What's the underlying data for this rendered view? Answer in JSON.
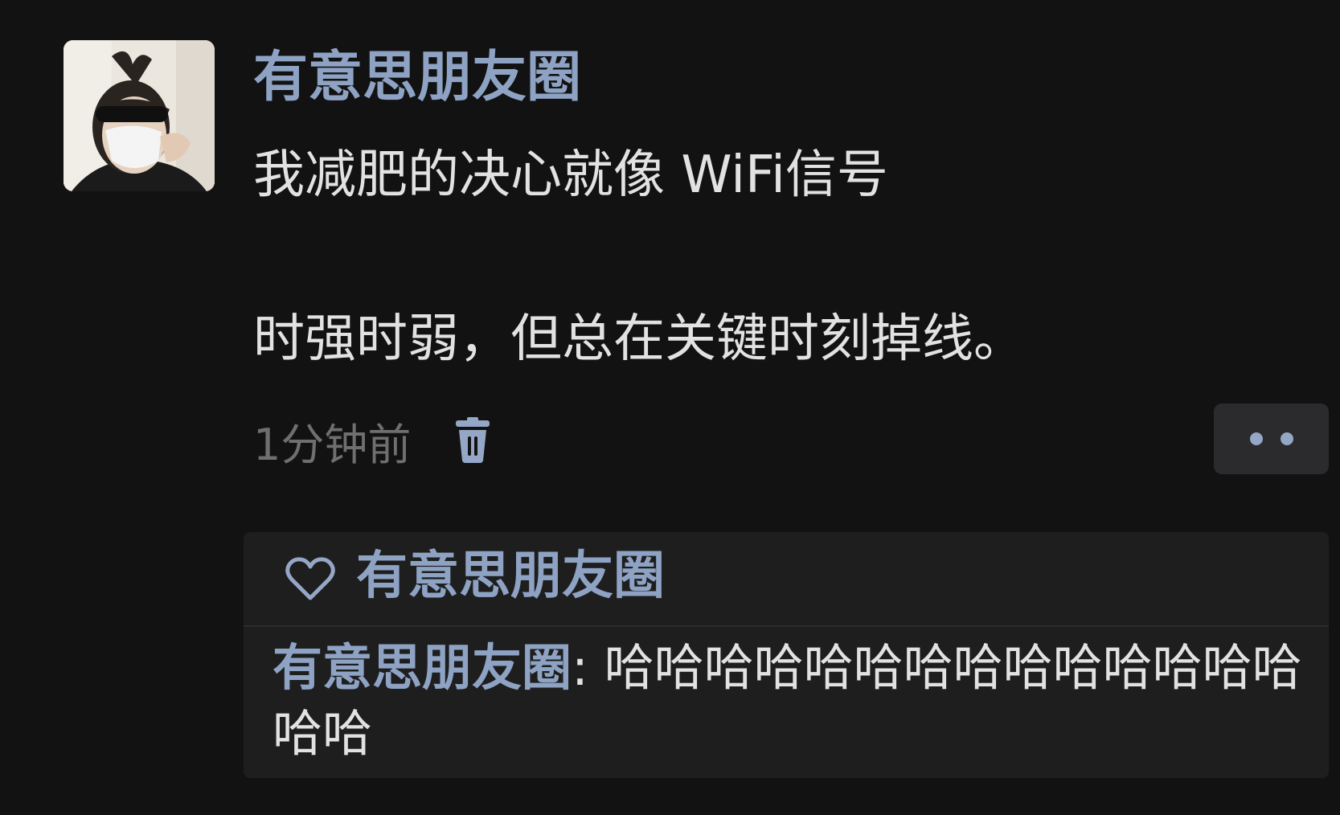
{
  "post": {
    "author": "有意思朋友圈",
    "text_line_1": "我减肥的决心就像 WiFi信号",
    "text_line_2": "时强时弱，但总在关键时刻掉线。",
    "timestamp": "1分钟前"
  },
  "likes": {
    "names": "有意思朋友圈"
  },
  "comment": {
    "author": "有意思朋友圈",
    "separator": ": ",
    "text": "哈哈哈哈哈哈哈哈哈哈哈哈哈哈哈哈"
  },
  "icons": {
    "delete": "trash-icon",
    "more": "more-dots-icon",
    "like": "heart-outline-icon"
  },
  "colors": {
    "background": "#121212",
    "name_accent": "#8ea3c4",
    "body_text": "#e2e2e2",
    "meta_text": "#6f6f6f",
    "panel": "#1e1e1e",
    "more_button": "#2b2b2d"
  }
}
